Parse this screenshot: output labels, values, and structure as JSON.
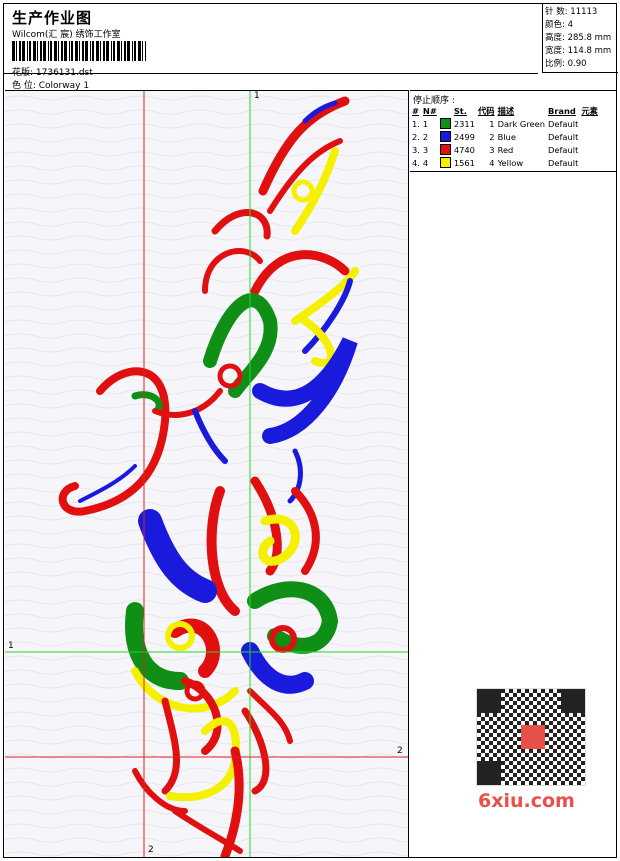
{
  "header": {
    "title": "生产作业图",
    "subtitle": "Wilcom(汇 宸) 绣饰工作室",
    "design_line": "花版: 1736131.dst",
    "colorway_line": "色 位: Colorway 1"
  },
  "stats": [
    {
      "label": "针 数:",
      "value": "11113"
    },
    {
      "label": "颜色:",
      "value": "4"
    },
    {
      "label": "高度:",
      "value": "285.8 mm"
    },
    {
      "label": "宽度:",
      "value": "114.8 mm"
    },
    {
      "label": "比例:",
      "value": "0.90"
    }
  ],
  "stop_sequence": {
    "title": "停止顺序 :",
    "columns": [
      "#",
      "N#",
      "St.",
      "代码",
      "描述",
      "Brand",
      "元素"
    ],
    "rows": [
      {
        "idx": "1.",
        "n": "1",
        "color": "#0f8f16",
        "st": "2311",
        "code": "1",
        "desc": "Dark Green",
        "brand": "Default"
      },
      {
        "idx": "2.",
        "n": "2",
        "color": "#1a1adc",
        "st": "2499",
        "code": "2",
        "desc": "Blue",
        "brand": "Default"
      },
      {
        "idx": "3.",
        "n": "3",
        "color": "#e01010",
        "st": "4740",
        "code": "3",
        "desc": "Red",
        "brand": "Default"
      },
      {
        "idx": "4.",
        "n": "4",
        "color": "#f4f000",
        "st": "1561",
        "code": "4",
        "desc": "Yellow",
        "brand": "Default"
      }
    ]
  },
  "markers": {
    "v_green": "1",
    "h_green": "1",
    "v_red": "2",
    "h_red": "2"
  },
  "colors": {
    "green_line": "#22d822",
    "red_line": "#e02020",
    "green": "#0f8f16",
    "blue": "#1a1adc",
    "red": "#e01010",
    "yellow": "#f4f000"
  },
  "watermark": "6xiu.com"
}
